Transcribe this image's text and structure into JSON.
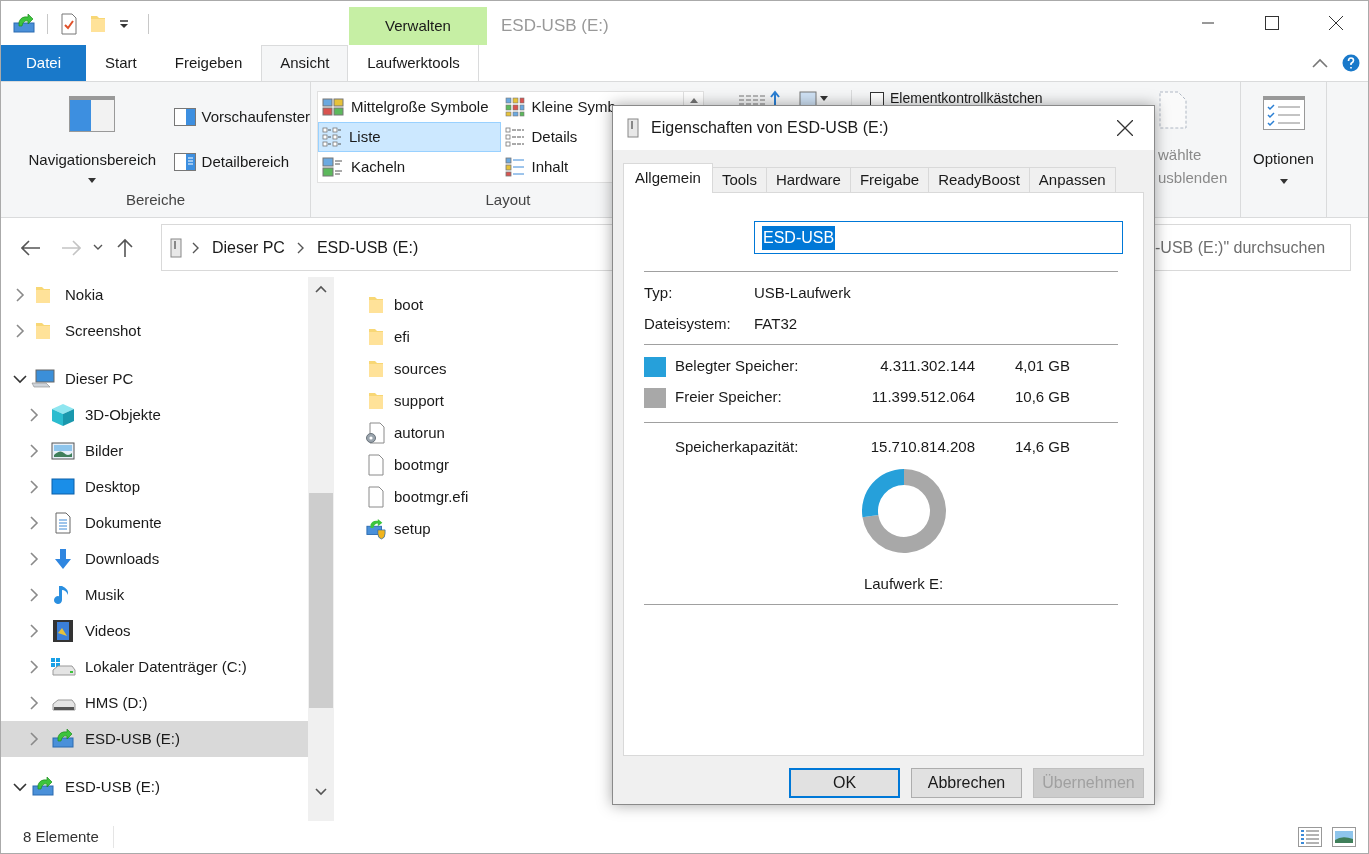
{
  "window": {
    "title": "ESD-USB (E:)",
    "contextual_header": "Verwalten"
  },
  "ribbon": {
    "tabs": [
      {
        "label": "Datei",
        "kind": "file",
        "selected": false
      },
      {
        "label": "Start",
        "kind": "tab",
        "selected": false
      },
      {
        "label": "Freigeben",
        "kind": "tab",
        "selected": false
      },
      {
        "label": "Ansicht",
        "kind": "tab",
        "selected": true
      },
      {
        "label": "Laufwerktools",
        "kind": "contextual",
        "selected": false
      }
    ],
    "panes": {
      "navigation_pane": "Navigationsbereich",
      "preview_pane": "Vorschaufenster",
      "details_pane": "Detailbereich",
      "label": "Bereiche"
    },
    "layout": {
      "label": "Layout",
      "items": [
        {
          "label": "Mittelgroße Symbole",
          "kind": "medium",
          "selected": false
        },
        {
          "label": "Kleine Symb",
          "kind": "small",
          "selected": false
        },
        {
          "label": "Liste",
          "kind": "list",
          "selected": true
        },
        {
          "label": "Details",
          "kind": "details",
          "selected": false
        },
        {
          "label": "Kacheln",
          "kind": "tiles",
          "selected": false
        },
        {
          "label": "Inhalt",
          "kind": "content",
          "selected": false
        }
      ]
    },
    "show_hide": {
      "checkbox": {
        "label": "Elementkontrollkästchen",
        "checked": false
      },
      "hide_selected": [
        "wählte",
        "usblenden"
      ]
    },
    "options": {
      "label": "Optionen"
    }
  },
  "address": {
    "crumbs": [
      "Dieser PC",
      "ESD-USB (E:)"
    ],
    "search_placeholder": "-USB (E:)\" durchsuchen"
  },
  "nav_tree": [
    {
      "children": [
        {
          "label": "Nokia",
          "kind": "folder",
          "expanded": false,
          "selected": false
        },
        {
          "label": "Screenshot",
          "kind": "folder",
          "expanded": false,
          "selected": false
        }
      ]
    },
    {
      "label": "Dieser PC",
      "kind": "pc",
      "expanded": true,
      "selected": false,
      "children": [
        {
          "label": "3D-Objekte",
          "kind": "cube",
          "expanded": false,
          "selected": false
        },
        {
          "label": "Bilder",
          "kind": "pictures",
          "expanded": false,
          "selected": false
        },
        {
          "label": "Desktop",
          "kind": "desktop",
          "expanded": false,
          "selected": false
        },
        {
          "label": "Dokumente",
          "kind": "documents",
          "expanded": false,
          "selected": false
        },
        {
          "label": "Downloads",
          "kind": "download",
          "expanded": false,
          "selected": false
        },
        {
          "label": "Musik",
          "kind": "music",
          "expanded": false,
          "selected": false
        },
        {
          "label": "Videos",
          "kind": "video",
          "expanded": false,
          "selected": false
        },
        {
          "label": "Lokaler Datenträger (C:)",
          "kind": "windrive",
          "expanded": false,
          "selected": false
        },
        {
          "label": "HMS (D:)",
          "kind": "drive",
          "expanded": false,
          "selected": false
        },
        {
          "label": "ESD-USB (E:)",
          "kind": "usb",
          "expanded": false,
          "selected": true
        }
      ]
    },
    {
      "label": "ESD-USB (E:)",
      "kind": "usb",
      "expanded": true,
      "selected": false
    }
  ],
  "files": [
    {
      "name": "boot",
      "kind": "folder"
    },
    {
      "name": "efi",
      "kind": "folder"
    },
    {
      "name": "sources",
      "kind": "folder"
    },
    {
      "name": "support",
      "kind": "folder"
    },
    {
      "name": "autorun",
      "kind": "settings"
    },
    {
      "name": "bootmgr",
      "kind": "file"
    },
    {
      "name": "bootmgr.efi",
      "kind": "file"
    },
    {
      "name": "setup",
      "kind": "setup"
    }
  ],
  "status_bar": {
    "count": "8 Elemente"
  },
  "dialog": {
    "title": "Eigenschaften von ESD-USB (E:)",
    "tabs": [
      {
        "label": "Allgemein",
        "selected": true
      },
      {
        "label": "Tools",
        "selected": false
      },
      {
        "label": "Hardware",
        "selected": false
      },
      {
        "label": "Freigabe",
        "selected": false
      },
      {
        "label": "ReadyBoost",
        "selected": false
      },
      {
        "label": "Anpassen",
        "selected": false
      }
    ],
    "name_value": "ESD-USB",
    "properties": [
      {
        "label": "Typ:",
        "value": "USB-Laufwerk"
      },
      {
        "label": "Dateisystem:",
        "value": "FAT32"
      }
    ],
    "space": [
      {
        "label": "Belegter Speicher:",
        "bytes": "4.311.302.144",
        "size": "4,01 GB",
        "color": "#26a0da"
      },
      {
        "label": "Freier Speicher:",
        "bytes": "11.399.512.064",
        "size": "10,6 GB",
        "color": "#a8a8a8"
      }
    ],
    "capacity": {
      "label": "Speicherkapazität:",
      "bytes": "15.710.814.208",
      "size": "14,6 GB"
    },
    "chart_data": {
      "type": "donut",
      "values": [
        27.4,
        72.6
      ]
    },
    "drive_label": "Laufwerk E:",
    "buttons": [
      {
        "label": "OK",
        "kind": "default",
        "disabled": false
      },
      {
        "label": "Abbrechen",
        "kind": "normal",
        "disabled": false
      },
      {
        "label": "Übernehmen",
        "kind": "normal",
        "disabled": true
      }
    ]
  }
}
